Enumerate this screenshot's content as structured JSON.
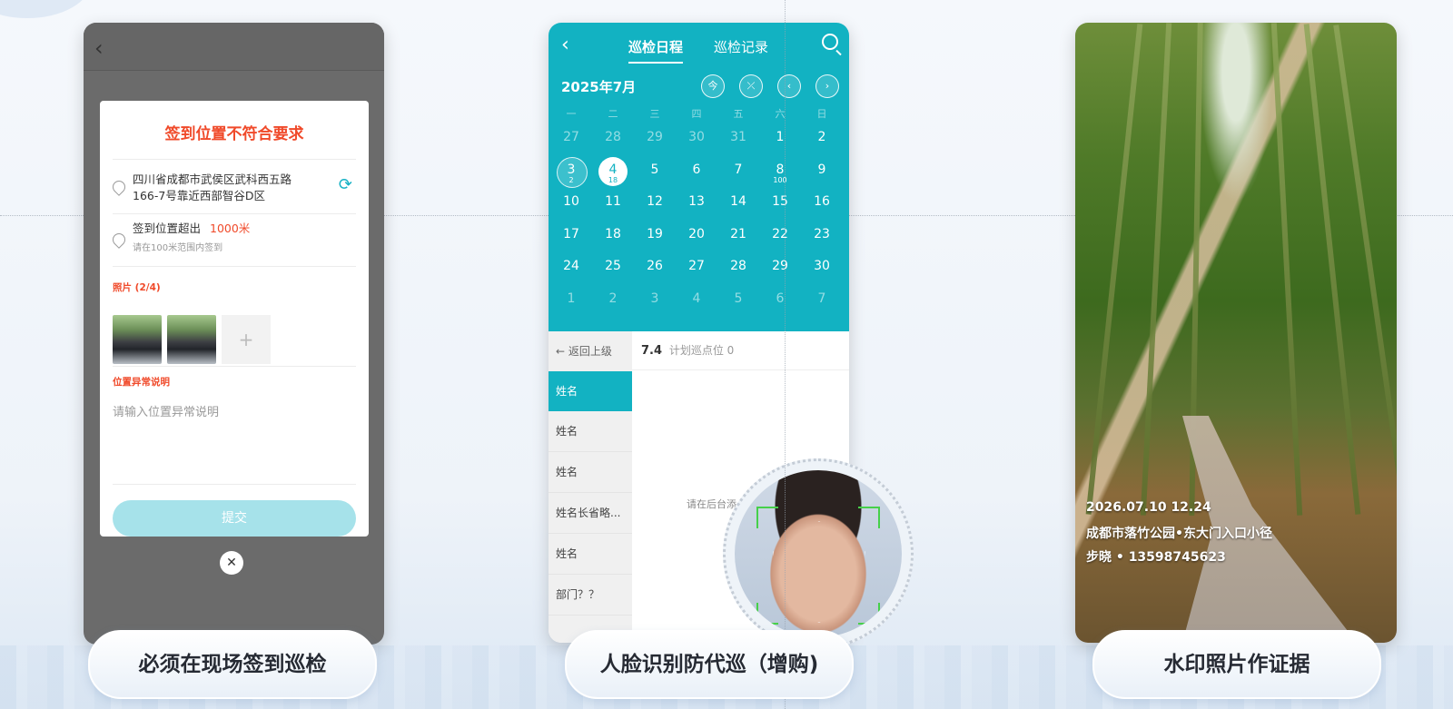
{
  "panel1": {
    "title": "签到位置不符合要求",
    "address": "四川省成都市武侯区武科西五路166-7号靠近西部智谷D区",
    "range_text": "签到位置超出",
    "range_value": "1000米",
    "range_hint": "请在100米范围内签到",
    "photos_label": "照片 (2/4)",
    "add_symbol": "+",
    "reason_label": "位置异常说明",
    "reason_placeholder": "请输入位置异常说明",
    "submit_label": "提交",
    "close_symbol": "✕",
    "back_symbol": "‹"
  },
  "panel2": {
    "back_symbol": "‹",
    "tabs": [
      "巡检日程",
      "巡检记录"
    ],
    "month": "2025年7月",
    "calendar_buttons": [
      "今",
      "⤫",
      "‹",
      "›"
    ],
    "weekdays": [
      "一",
      "二",
      "三",
      "四",
      "五",
      "六",
      "日"
    ],
    "weeks": [
      [
        {
          "d": "27",
          "dim": true
        },
        {
          "d": "28",
          "dim": true
        },
        {
          "d": "29",
          "dim": true
        },
        {
          "d": "30",
          "dim": true
        },
        {
          "d": "31",
          "dim": true
        },
        {
          "d": "1"
        },
        {
          "d": "2"
        }
      ],
      [
        {
          "d": "3",
          "sub": "2",
          "mark": "ring"
        },
        {
          "d": "4",
          "sub": "18",
          "mark": "today"
        },
        {
          "d": "5"
        },
        {
          "d": "6"
        },
        {
          "d": "7"
        },
        {
          "d": "8",
          "sub": "100"
        },
        {
          "d": "9"
        }
      ],
      [
        {
          "d": "10"
        },
        {
          "d": "11"
        },
        {
          "d": "12"
        },
        {
          "d": "13"
        },
        {
          "d": "14"
        },
        {
          "d": "15"
        },
        {
          "d": "16"
        }
      ],
      [
        {
          "d": "17"
        },
        {
          "d": "18"
        },
        {
          "d": "19"
        },
        {
          "d": "20"
        },
        {
          "d": "21"
        },
        {
          "d": "22"
        },
        {
          "d": "23"
        }
      ],
      [
        {
          "d": "24"
        },
        {
          "d": "25"
        },
        {
          "d": "26"
        },
        {
          "d": "27"
        },
        {
          "d": "28"
        },
        {
          "d": "29"
        },
        {
          "d": "30"
        }
      ],
      [
        {
          "d": "1",
          "dim": true
        },
        {
          "d": "2",
          "dim": true
        },
        {
          "d": "3",
          "dim": true
        },
        {
          "d": "4",
          "dim": true
        },
        {
          "d": "5",
          "dim": true
        },
        {
          "d": "6",
          "dim": true
        },
        {
          "d": "7",
          "dim": true
        }
      ]
    ],
    "back_up": "返回上级",
    "date": "7.4",
    "planned_points": "计划巡点位 0",
    "names": [
      "姓名",
      "姓名",
      "姓名",
      "姓名长省略...",
      "姓名",
      "部门？？"
    ],
    "hint_text": "请在后台添"
  },
  "panel3": {
    "watermark": [
      "2026.07.10  12.24",
      "成都市落竹公园•东大门入口小径",
      "步晓 • 13598745623"
    ]
  },
  "captions": [
    "必须在现场签到巡检",
    "人脸识别防代巡（增购)",
    "水印照片作证据"
  ],
  "colors": {
    "accent": "#12b2c2",
    "warning": "#f04a2a",
    "face_frame": "#46d04a"
  }
}
